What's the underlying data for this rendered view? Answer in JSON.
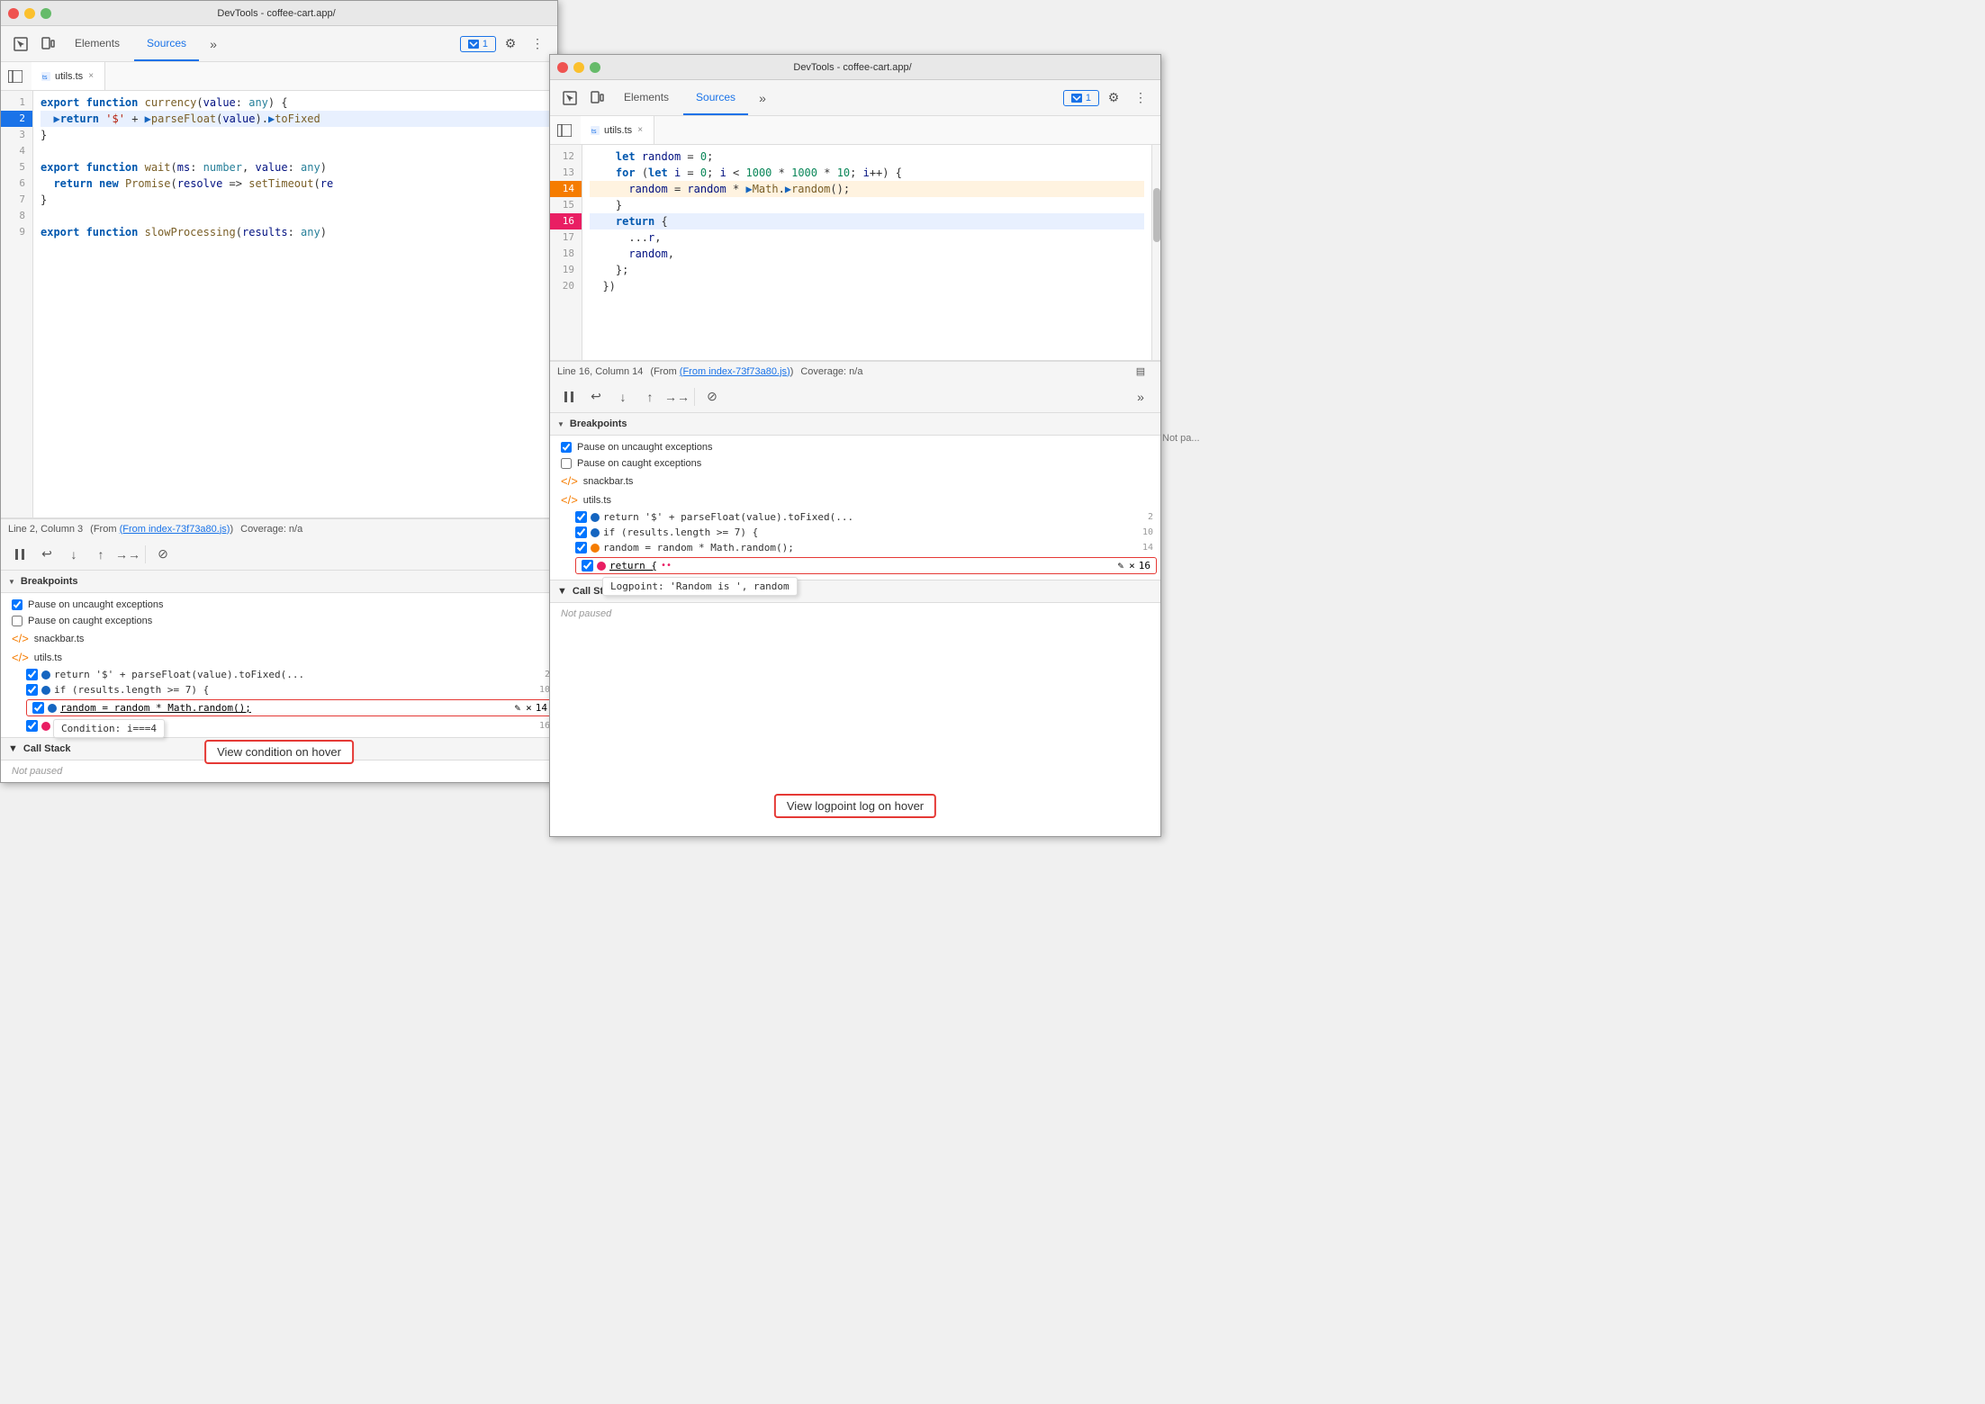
{
  "leftWindow": {
    "title": "DevTools - coffee-cart.app/",
    "tabs": [
      "Elements",
      "Sources"
    ],
    "activeTab": "Sources",
    "consoleBadge": "1",
    "fileTab": "utils.ts",
    "statusBar": {
      "position": "Line 2, Column 3",
      "from": "(From index-73f73a80.js)",
      "coverage": "Coverage: n/a"
    },
    "code": {
      "lines": [
        {
          "num": "1",
          "text": "export function currency(value: any) {",
          "active": false,
          "breakpoint": false
        },
        {
          "num": "2",
          "text": "  ▶return '$' + ▶parseFloat(value).▶toFixed",
          "active": true,
          "breakpoint": false
        },
        {
          "num": "3",
          "text": "}",
          "active": false,
          "breakpoint": false
        },
        {
          "num": "4",
          "text": "",
          "active": false,
          "breakpoint": false
        },
        {
          "num": "5",
          "text": "export function wait(ms: number, value: any)",
          "active": false,
          "breakpoint": false
        },
        {
          "num": "6",
          "text": "  return new Promise(resolve => setTimeout(re",
          "active": false,
          "breakpoint": false
        },
        {
          "num": "7",
          "text": "}",
          "active": false,
          "breakpoint": false
        },
        {
          "num": "8",
          "text": "",
          "active": false,
          "breakpoint": false
        },
        {
          "num": "9",
          "text": "export function slowProcessing(results: any)",
          "active": false,
          "breakpoint": false
        }
      ]
    },
    "breakpoints": {
      "header": "Breakpoints",
      "pauseUncaught": "Pause on uncaught exceptions",
      "pauseCaught": "Pause on caught exceptions",
      "files": [
        {
          "name": "snackbar.ts",
          "items": []
        },
        {
          "name": "utils.ts",
          "items": [
            {
              "text": "return '$' + parseFloat(value).toFixed(...",
              "line": "2",
              "checked": true
            },
            {
              "text": "if (results.length >= 7) {",
              "line": "10",
              "checked": true
            },
            {
              "text": "random = random * Math.random();",
              "line": "14",
              "checked": true,
              "highlighted": true,
              "condition": "Condition: i===4"
            },
            {
              "text": "return {",
              "line": "16",
              "checked": true
            }
          ]
        }
      ]
    },
    "callStack": "Call Stack"
  },
  "rightWindow": {
    "title": "DevTools - coffee-cart.app/",
    "tabs": [
      "Elements",
      "Sources"
    ],
    "activeTab": "Sources",
    "consoleBadge": "1",
    "fileTab": "utils.ts",
    "statusBar": {
      "position": "Line 16, Column 14",
      "from": "(From index-73f73a80.js)",
      "coverage": "Coverage: n/a"
    },
    "code": {
      "lines": [
        {
          "num": "12",
          "text": "    let random = 0;",
          "active": false,
          "breakpoint": false
        },
        {
          "num": "13",
          "text": "    for (let i = 0; i < 1000 * 1000 * 10; i++) {",
          "active": false,
          "breakpoint": false
        },
        {
          "num": "14",
          "text": "      random = random * ▶Math.▶random();",
          "active": false,
          "breakpoint": true,
          "bpColor": "orange"
        },
        {
          "num": "15",
          "text": "    }",
          "active": false,
          "breakpoint": false
        },
        {
          "num": "16",
          "text": "    return {",
          "active": true,
          "breakpoint": true,
          "bpColor": "pink"
        },
        {
          "num": "17",
          "text": "      ...r,",
          "active": false,
          "breakpoint": false
        },
        {
          "num": "18",
          "text": "      random,",
          "active": false,
          "breakpoint": false
        },
        {
          "num": "19",
          "text": "    };",
          "active": false,
          "breakpoint": false
        },
        {
          "num": "20",
          "text": "  })",
          "active": false,
          "breakpoint": false
        }
      ]
    },
    "breakpoints": {
      "header": "Breakpoints",
      "pauseUncaught": "Pause on uncaught exceptions",
      "pauseCaught": "Pause on caught exceptions",
      "files": [
        {
          "name": "snackbar.ts",
          "items": []
        },
        {
          "name": "utils.ts",
          "items": [
            {
              "text": "return '$' + parseFloat(value).toFixed(...",
              "line": "2",
              "checked": true
            },
            {
              "text": "if (results.length >= 7) {",
              "line": "10",
              "checked": true
            },
            {
              "text": "random = random * Math.random();",
              "line": "14",
              "checked": true
            },
            {
              "text": "return {",
              "line": "16",
              "checked": true,
              "highlighted": true,
              "logpoint": "Logpoint: 'Random is ', random"
            }
          ]
        }
      ]
    },
    "callStack": "Call Stack",
    "notPaused": "Not pa..."
  },
  "annotations": {
    "leftLabel": "View condition on hover",
    "rightLabel": "View logpoint log on hover"
  },
  "icons": {
    "inspect": "⬚",
    "device": "⬜",
    "more": "»",
    "gear": "⚙",
    "dots": "⋮",
    "sidebar": "▣",
    "close": "×",
    "triangle_down": "▼",
    "triangle_right": "▶",
    "pause": "⏸",
    "step_over": "↩",
    "step_into": "↓",
    "step_out": "↑",
    "continue": "→→",
    "deactivate": "⊘",
    "edit": "✎",
    "delete": "×"
  }
}
